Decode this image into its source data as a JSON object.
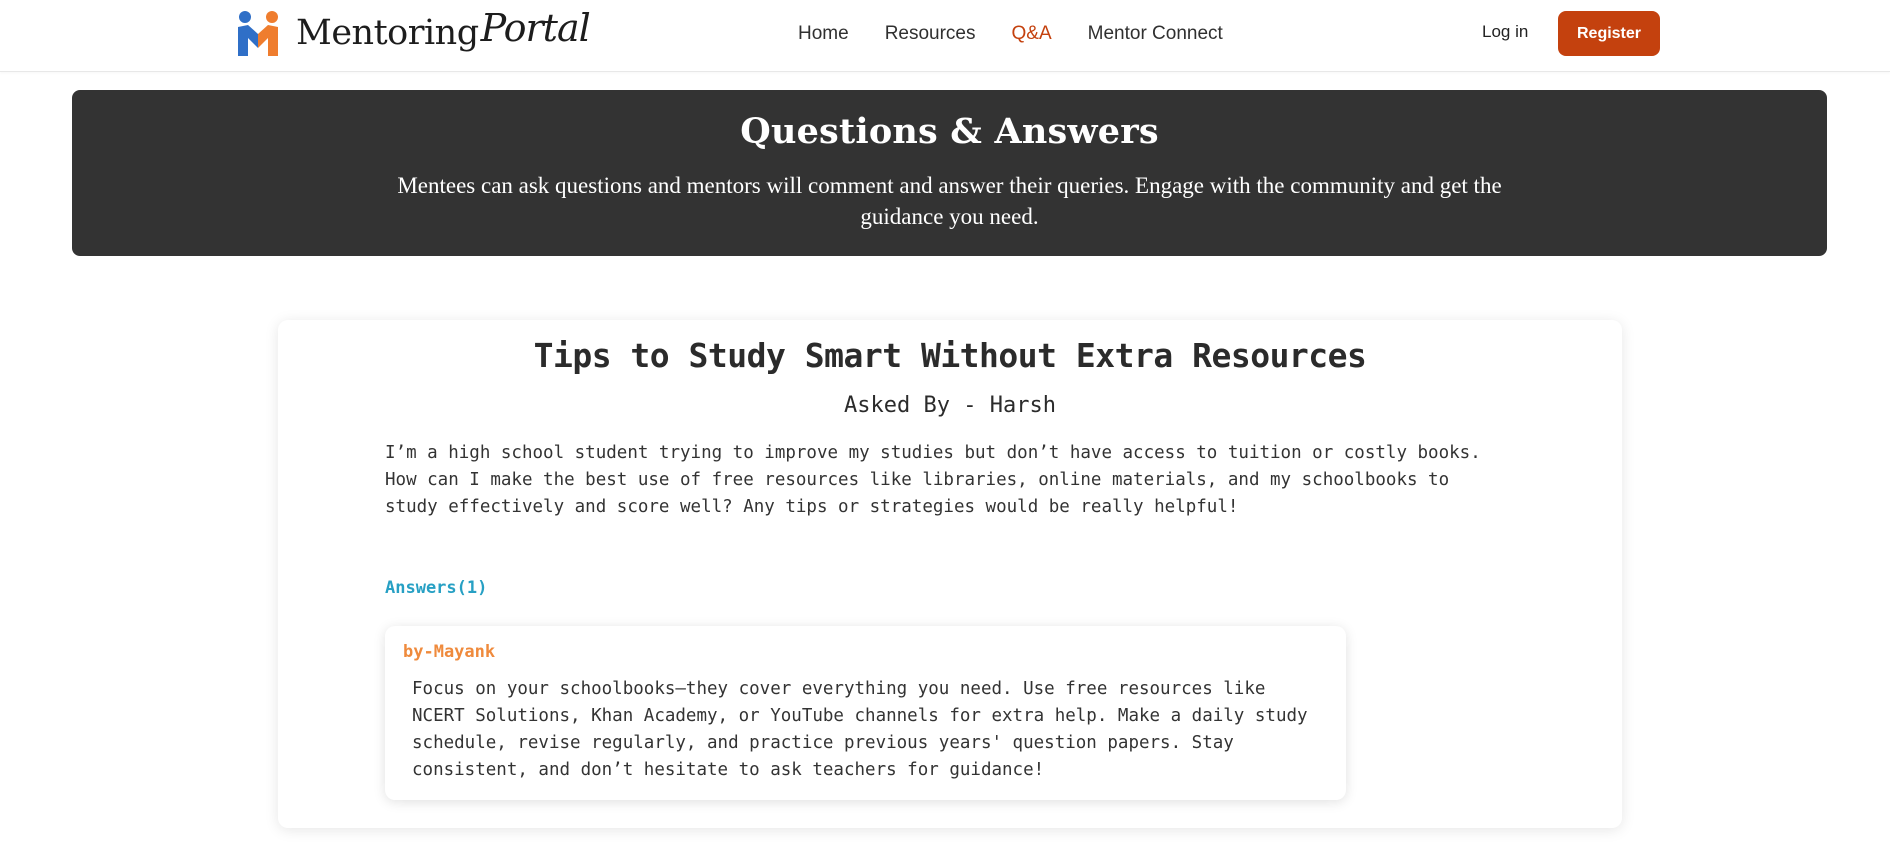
{
  "header": {
    "brand_main": "Mentoring",
    "brand_script": "Portal",
    "nav": [
      {
        "label": "Home"
      },
      {
        "label": "Resources"
      },
      {
        "label": "Q&A"
      },
      {
        "label": "Mentor Connect"
      }
    ],
    "login_label": "Log in",
    "register_label": "Register"
  },
  "hero": {
    "title": "Questions & Answers",
    "subtitle": "Mentees can ask questions and mentors will comment and answer their queries. Engage with the community and get the guidance you need."
  },
  "question": {
    "title": "Tips to Study Smart Without Extra Resources",
    "asked_by": "Asked By - Harsh",
    "body": "I’m a high school student trying to improve my studies but don’t have access to tuition or costly books. How can I make the best use of free resources like libraries, online materials, and my schoolbooks to study effectively and score well? Any tips or strategies would be really helpful!",
    "answers_label": "Answers(1)",
    "answers": [
      {
        "author": "by-Mayank",
        "body": "Focus on your schoolbooks—they cover everything you need. Use free resources like NCERT Solutions, Khan Academy, or YouTube channels for extra help. Make a daily study schedule, revise regularly, and practice previous years' question papers. Stay consistent, and don’t hesitate to ask teachers for guidance!"
      }
    ]
  },
  "colors": {
    "accent": "#c4410e",
    "hero_bg": "#333333",
    "answers_label": "#27a0c4",
    "answer_author": "#ef8a3c",
    "logo_blue": "#2f6fc7",
    "logo_orange": "#ef7d2e"
  }
}
